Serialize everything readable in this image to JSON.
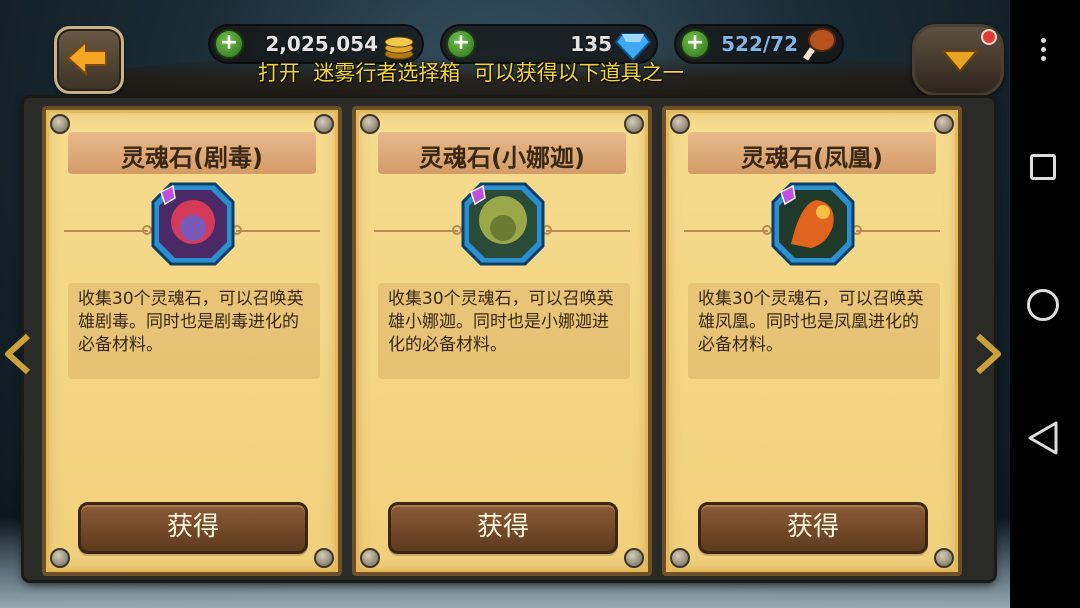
{
  "resources": {
    "gold": "2,025,054",
    "gems": "135",
    "stamina": "522/72"
  },
  "announcement": "打开  迷雾行者选择箱  可以获得以下道具之一",
  "cards": [
    {
      "title": "灵魂石(剧毒)",
      "description": "收集30个灵魂石，可以召唤英雄剧毒。同时也是剧毒进化的必备材料。",
      "button": "获得",
      "portrait_icon": "poison-hero-portrait",
      "portrait_color": "#d43a5a"
    },
    {
      "title": "灵魂石(小娜迦)",
      "description": "收集30个灵魂石，可以召唤英雄小娜迦。同时也是小娜迦进化的必备材料。",
      "button": "获得",
      "portrait_icon": "naga-hero-portrait",
      "portrait_color": "#9aa84a"
    },
    {
      "title": "灵魂石(凤凰)",
      "description": "收集30个灵魂石，可以召唤英雄凤凰。同时也是凤凰进化的必备材料。",
      "button": "获得",
      "portrait_icon": "phoenix-hero-portrait",
      "portrait_color": "#e0641e"
    }
  ],
  "colors": {
    "announcement": "#f3d43b",
    "card_bg": "#f6dc8f",
    "button_bg": "#6e4526"
  }
}
